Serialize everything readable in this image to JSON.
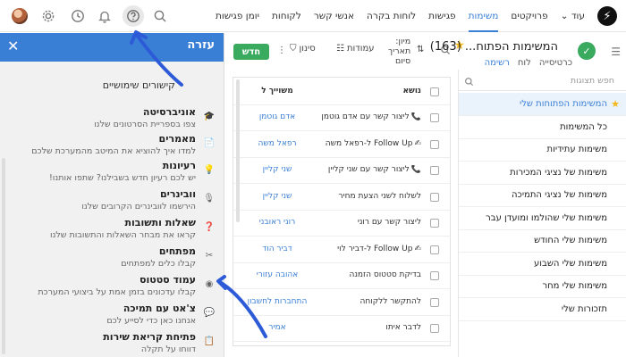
{
  "topbar": {
    "nav": [
      "יומן פגישות",
      "לקוחות",
      "אנשי קשר",
      "לוחות בקרה",
      "פגישות",
      "משימות",
      "פרויקטים",
      "עוד"
    ],
    "active_index": 5,
    "more_caret": "⌄",
    "logo_glyph": "⚡",
    "icons": [
      "avatar",
      "gear-icon",
      "clock-icon",
      "bell-icon",
      "help-icon",
      "search-icon"
    ]
  },
  "help": {
    "title": "עזרה",
    "close": "✕",
    "subtitle": "קישורים שימושיים",
    "items": [
      {
        "title": "אוניברסיטה",
        "desc": "צפו בספריית הסרטונים שלנו",
        "icon": "🎓"
      },
      {
        "title": "מאמרים",
        "desc": "למדו איך להוציא את המיטב מהמערכת שלכם",
        "icon": "📄"
      },
      {
        "title": "רעיונות",
        "desc": "יש לכם רעיון חדש בשבילנו? שתפו אותנו!",
        "icon": "💡"
      },
      {
        "title": "וובינרים",
        "desc": "הירשמו לוובינרים הקרובים שלנו",
        "icon": "🎙"
      },
      {
        "title": "שאלות ותשובות",
        "desc": "קראו את מבחר השאלות והתשובות שלנו",
        "icon": "❓"
      },
      {
        "title": "מפתחים",
        "desc": "קבלו כלים למפתחים",
        "icon": "✂"
      },
      {
        "title": "עמוד סטטוס",
        "desc": "קבלו עדכונים בזמן אמת על ביצועי המערכת",
        "icon": "◉"
      },
      {
        "title": "צ'אט עם תמיכה",
        "desc": "אנחנו כאן כדי לסייע לכם",
        "icon": "💬"
      },
      {
        "title": "פתיחת קריאת שירות",
        "desc": "דווחו על תקלה",
        "icon": "📋"
      }
    ]
  },
  "toolbar": {
    "new_label": "חדש",
    "filter_label": "סינון",
    "columns_label": "עמודות",
    "sort_label": "מיון:",
    "sort_value_1": "תאריך",
    "sort_value_2": "סיום",
    "title": "המשימות הפתוח...",
    "count": "(163)",
    "tabs": [
      "רשימה",
      "לוח",
      "כרטיסייה"
    ],
    "active_tab": 0
  },
  "sidebar": {
    "search_placeholder": "חפש תצוגות",
    "items": [
      "המשימות הפתוחות שלי",
      "כל המשימות",
      "משימות עתידיות",
      "משימות של נציגי המכירות",
      "משימות של נציגי התמיכה",
      "משימות שלי שהולמו ומועדן עבר",
      "משימות שלי החודש",
      "משימות שלי השבוע",
      "משימות שלי מחר",
      "תזכורות שלי"
    ],
    "active_index": 0
  },
  "table": {
    "headers": {
      "subject": "נושא",
      "assignee": "משוייך ל"
    },
    "rows": [
      {
        "subject": "ליצור קשר עם אדם גוטמן",
        "assignee": "אדם גוטמן",
        "icon": "📞"
      },
      {
        "subject": "Follow Up ל-רפאל משה",
        "assignee": "רפאל משה",
        "icon": "✍"
      },
      {
        "subject": "ליצור קשר עם שני קליין",
        "assignee": "שני קליין",
        "icon": "📞"
      },
      {
        "subject": "לשלוח לשני הצעת מחיר",
        "assignee": "שני קליין",
        "icon": ""
      },
      {
        "subject": "ליצור קשר עם רוני",
        "assignee": "רוני ראובני",
        "icon": ""
      },
      {
        "subject": "Follow Up ל-דביר לוי",
        "assignee": "דביר הוד",
        "icon": "✍"
      },
      {
        "subject": "בדיקת סטטוס הזמנה",
        "assignee": "אהובה עזורי",
        "icon": ""
      },
      {
        "subject": "להתקשר ללקוחה",
        "assignee": "התחברות לחשבון",
        "icon": ""
      },
      {
        "subject": "לדבר איתו",
        "assignee": "אמיר",
        "icon": ""
      }
    ]
  },
  "colors": {
    "accent": "#3a7fd6",
    "new_button": "#3aaa5e",
    "star": "#f3b71b"
  }
}
